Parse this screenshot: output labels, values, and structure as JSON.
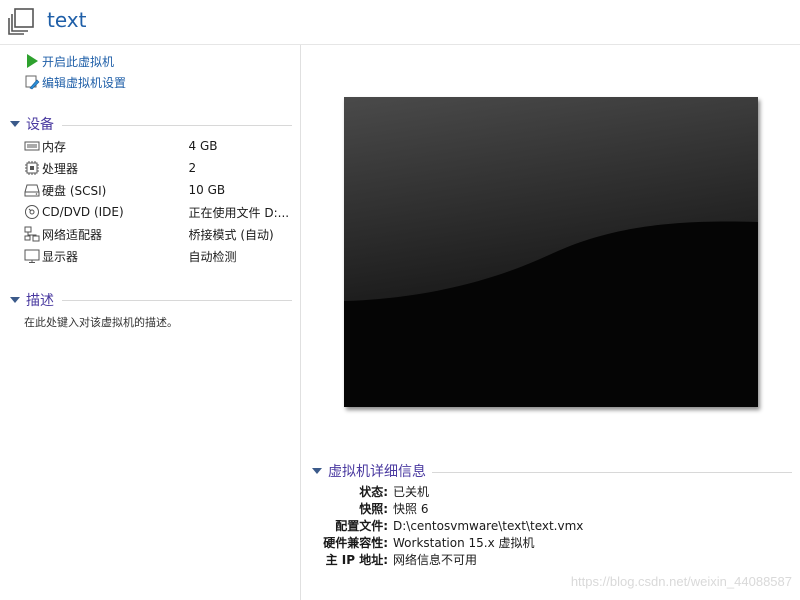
{
  "header": {
    "title": "text",
    "icon": "vm-window-icon"
  },
  "actions": {
    "power_on": {
      "label": "开启此虚拟机",
      "icon": "play-icon"
    },
    "edit_settings": {
      "label": "编辑虚拟机设置",
      "icon": "edit-settings-icon"
    }
  },
  "devices": {
    "title": "设备",
    "items": [
      {
        "name": "内存",
        "value": "4 GB",
        "icon": "memory-icon"
      },
      {
        "name": "处理器",
        "value": "2",
        "icon": "processor-icon"
      },
      {
        "name": "硬盘 (SCSI)",
        "value": "10 GB",
        "icon": "hard-disk-icon"
      },
      {
        "name": "CD/DVD (IDE)",
        "value": "正在使用文件 D:...",
        "icon": "cd-dvd-icon"
      },
      {
        "name": "网络适配器",
        "value": "桥接模式 (自动)",
        "icon": "network-adapter-icon"
      },
      {
        "name": "显示器",
        "value": "自动检测",
        "icon": "display-icon"
      }
    ]
  },
  "description": {
    "title": "描述",
    "placeholder": "在此处键入对该虚拟机的描述。"
  },
  "details": {
    "title": "虚拟机详细信息",
    "rows": [
      {
        "key": "状态:",
        "value": "已关机"
      },
      {
        "key": "快照:",
        "value": "快照 6"
      },
      {
        "key": "配置文件:",
        "value": "D:\\centosvmware\\text\\text.vmx"
      },
      {
        "key": "硬件兼容性:",
        "value": "Workstation 15.x 虚拟机"
      },
      {
        "key": "主 IP 地址:",
        "value": "网络信息不可用"
      }
    ]
  },
  "watermark": "https://blog.csdn.net/weixin_44088587",
  "colors": {
    "link": "#1f5fa8",
    "section": "#4a3aa0",
    "play": "#2ea12e"
  }
}
